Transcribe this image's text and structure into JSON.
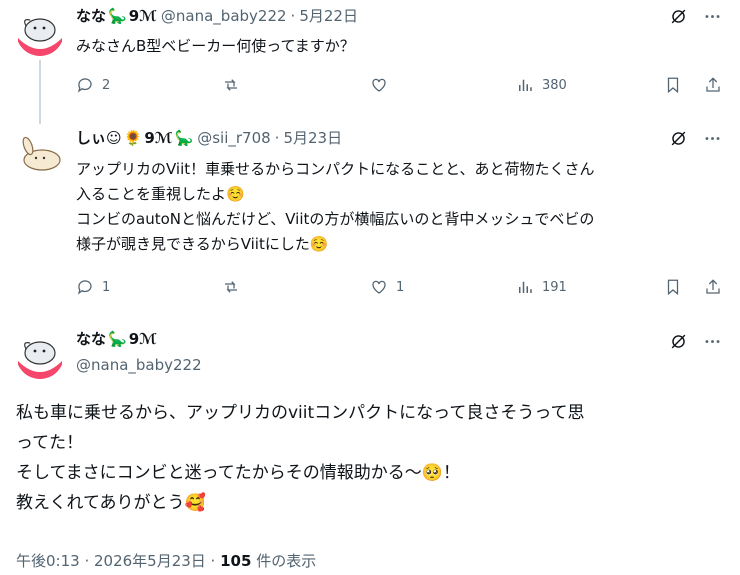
{
  "tweets": [
    {
      "name": "なな",
      "badge": "9ℳ",
      "handle": "@nana_baby222",
      "date": "5月22日",
      "lines": [
        "みなさんB型ベビーカー何使ってますか？"
      ],
      "replies": "2",
      "retweets": "",
      "likes": "",
      "views": "380"
    },
    {
      "name": "しぃ☺",
      "badge": "9ℳ",
      "handle": "@sii_r708",
      "date": "5月23日",
      "lines": [
        "アップリカのViit！車乗せるからコンパクトになることと、あと荷物たくさん",
        "入ることを重視したよ☺️",
        "コンビのautoNと悩んだけど、Viitの方が横幅広いのと背中メッシュでベビの",
        "様子が覗き見できるからViitにした☺️"
      ],
      "replies": "1",
      "retweets": "",
      "likes": "1",
      "views": "191"
    }
  ],
  "main": {
    "name": "なな",
    "badge": "9ℳ",
    "handle": "@nana_baby222",
    "lines": [
      "私も車に乗せるから、アップリカのviitコンパクトになって良さそうって思",
      "ってた！",
      "そしてまさにコンビと迷ってたからその情報助かる〜🥺！",
      "教えくれてありがとう🥰"
    ],
    "footer_time": "午後0:13 · 2026年5月23日 · ",
    "footer_views": "105",
    "footer_views_label": " 件の表示"
  }
}
